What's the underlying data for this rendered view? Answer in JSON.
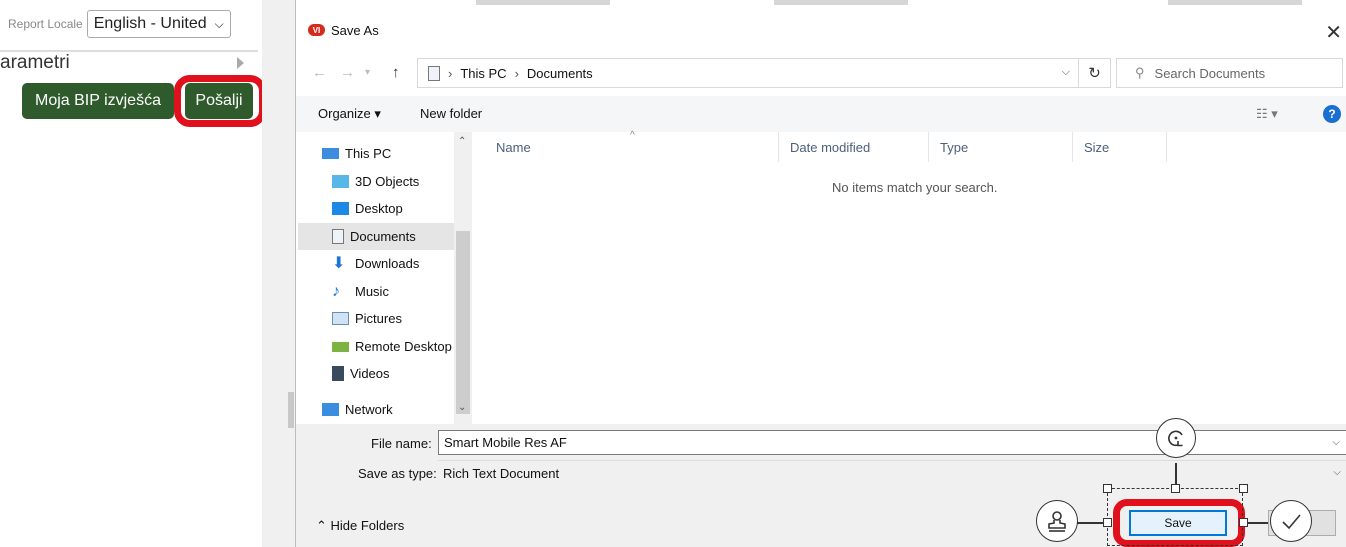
{
  "app": {
    "locale_label": "Report Locale",
    "locale_value": "English - United",
    "params_label": "arametri",
    "bip_button": "Moja BIP izvješća",
    "send_button": "Pošalji"
  },
  "dialog": {
    "title": "Save As",
    "app_icon_text": "VI",
    "breadcrumb": [
      "This PC",
      "Documents"
    ],
    "search_placeholder": "Search Documents",
    "toolbar": {
      "organize": "Organize ▾",
      "new_folder": "New folder"
    },
    "nav_items": [
      {
        "label": "This PC",
        "icon": "pc-icon"
      },
      {
        "label": "3D Objects",
        "icon": "cube-icon"
      },
      {
        "label": "Desktop",
        "icon": "desktop-icon"
      },
      {
        "label": "Documents",
        "icon": "document-icon",
        "selected": true
      },
      {
        "label": "Downloads",
        "icon": "download-icon"
      },
      {
        "label": "Music",
        "icon": "music-icon"
      },
      {
        "label": "Pictures",
        "icon": "picture-icon"
      },
      {
        "label": "Remote Desktop",
        "icon": "remote-desktop-icon"
      },
      {
        "label": "Videos",
        "icon": "video-icon"
      },
      {
        "label": "Network",
        "icon": "network-icon"
      }
    ],
    "columns": [
      "Name",
      "Date modified",
      "Type",
      "Size"
    ],
    "empty_message": "No items match your search.",
    "file_name_label": "File name:",
    "file_name_value": "Smart Mobile Res AF",
    "save_type_label": "Save as type:",
    "save_type_value": "Rich Text Document",
    "hide_folders": "Hide Folders",
    "save_button": "Save",
    "accent": "#0078d7",
    "highlight": "#e0101c"
  }
}
